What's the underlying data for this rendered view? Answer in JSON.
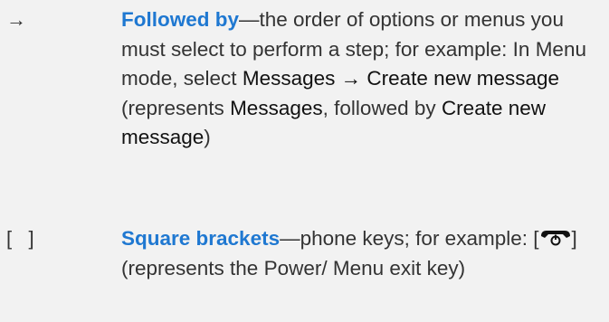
{
  "entries": [
    {
      "symbol": "→",
      "term": "Followed by",
      "dash": "—",
      "desc_1": "the order of options or menus you must select to perform a step; for example: In Menu mode, select ",
      "menu_a": "Messages",
      "arrow": " → ",
      "menu_b": "Create new message",
      "desc_2": " (represents ",
      "menu_c": "Messages",
      "desc_3": ", followed by ",
      "menu_d": "Create new message",
      "desc_4": ")"
    },
    {
      "symbol": "[   ]",
      "term": "Square brackets",
      "dash": "—",
      "desc_1": "phone keys; for example: [",
      "key_icon": "power-end-key-icon",
      "desc_2": "] (represents the Power/ Menu exit key)"
    }
  ],
  "colors": {
    "term": "#1f78d1",
    "text": "#333333",
    "background": "#f2f2f2"
  }
}
